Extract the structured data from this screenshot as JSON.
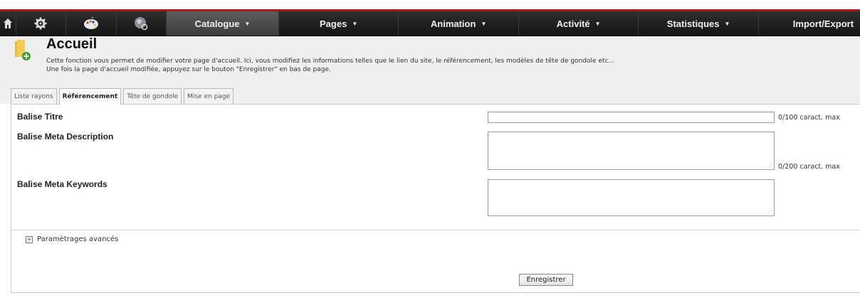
{
  "nav": {
    "icons": [
      "home-icon",
      "gear-icon",
      "palette-icon",
      "globe-icon"
    ],
    "menus": [
      {
        "label": "Catalogue",
        "has_caret": true,
        "active": true
      },
      {
        "label": "Pages",
        "has_caret": true,
        "active": false
      },
      {
        "label": "Animation",
        "has_caret": true,
        "active": false
      },
      {
        "label": "Activité",
        "has_caret": true,
        "active": false
      },
      {
        "label": "Statistiques",
        "has_caret": true,
        "active": false
      },
      {
        "label": "Import/Export",
        "has_caret": false,
        "active": false
      }
    ],
    "accent": "#b31217"
  },
  "header": {
    "title": "Accueil",
    "icon": "folder-add-icon",
    "desc_line1": "Cette fonction vous permet de modifier votre page d'accueil. Ici, vous modifiez les informations telles que le lien du site, le référencement, les modèles de tête de gondole etc...",
    "desc_line2": "Une fois la page d'accueil modifiée, appuyez sur le bouton \"Enregistrer\" en bas de page."
  },
  "tabs": [
    {
      "label": "Liste rayons",
      "active": false
    },
    {
      "label": "Référencement",
      "active": true
    },
    {
      "label": "Tête de gondole",
      "active": false
    },
    {
      "label": "Mise en page",
      "active": false
    }
  ],
  "form": {
    "title_label": "Balise Titre",
    "title_value": "",
    "title_counter": "0/100 caract. max",
    "description_label": "Balise Meta Description",
    "description_value": "",
    "description_counter": "0/200 caract. max",
    "keywords_label": "Balise Meta Keywords",
    "keywords_value": ""
  },
  "advanced": {
    "label": "Paramètrages avancés",
    "toggle": "+"
  },
  "save_label": "Enregistrer"
}
